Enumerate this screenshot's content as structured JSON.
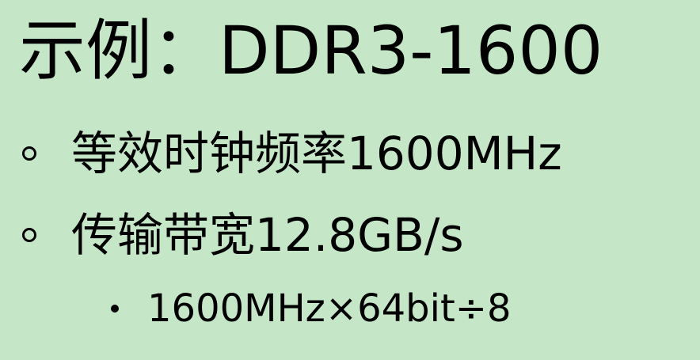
{
  "slide": {
    "title": "示例：DDR3-1600",
    "bullets": [
      {
        "text": "等效时钟频率1600MHz"
      },
      {
        "text": "传输带宽12.8GB/s"
      }
    ],
    "sub_bullets": [
      {
        "text": "1600MHz×64bit÷8"
      }
    ]
  }
}
